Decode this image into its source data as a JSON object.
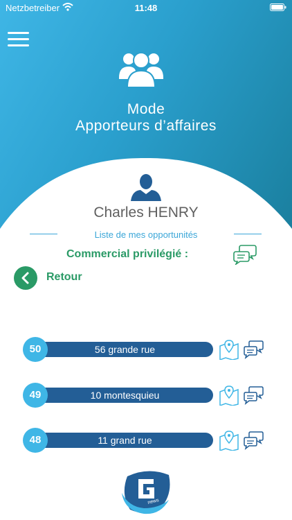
{
  "status": {
    "carrier": "Netzbetreiber",
    "time": "11:48"
  },
  "header": {
    "mode_line1": "Mode",
    "mode_line2": "Apporteurs d’affaires"
  },
  "user": {
    "name": "Charles HENRY"
  },
  "list": {
    "title": "Liste de mes opportunités",
    "commercial_label": "Commercial privilégié :",
    "back_label": "Retour"
  },
  "opportunities": [
    {
      "number": "50",
      "address": "56 grande rue"
    },
    {
      "number": "49",
      "address": "10 montesquieu"
    },
    {
      "number": "48",
      "address": "11 grand rue"
    }
  ],
  "logo": {
    "text": "news"
  },
  "colors": {
    "accent_blue": "#3fb6e6",
    "bar_blue": "#235e96",
    "green": "#2a9a66",
    "label_blue": "#3aa6d8"
  }
}
